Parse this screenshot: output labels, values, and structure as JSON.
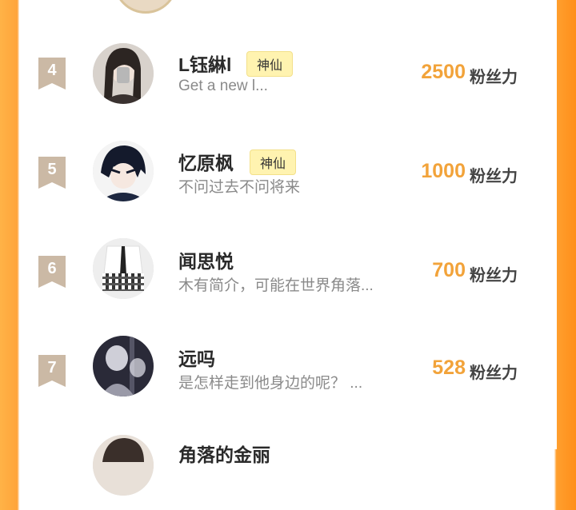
{
  "list": {
    "rows": [
      {
        "rank": "4",
        "name": "L钰綝l",
        "badge": "神仙",
        "subtitle": "Get a new l...",
        "score": "2500",
        "unit": "粉丝力"
      },
      {
        "rank": "5",
        "name": "忆原枫",
        "badge": "神仙",
        "subtitle": "不问过去不问将来",
        "score": "1000",
        "unit": "粉丝力"
      },
      {
        "rank": "6",
        "name": "闻思悦",
        "badge": "",
        "subtitle": "木有简介，可能在世界角落...",
        "score": "700",
        "unit": "粉丝力"
      },
      {
        "rank": "7",
        "name": "远吗",
        "badge": "",
        "subtitle": "是怎样走到他身边的呢？ ...",
        "score": "528",
        "unit": "粉丝力"
      },
      {
        "rank": "",
        "name": "角落的金丽",
        "badge": "",
        "subtitle": "",
        "score": "",
        "unit": ""
      }
    ]
  },
  "colors": {
    "accent": "#f2a33a",
    "badge_bg": "#fff3b0",
    "rank_bg": "#cbb9a5"
  }
}
